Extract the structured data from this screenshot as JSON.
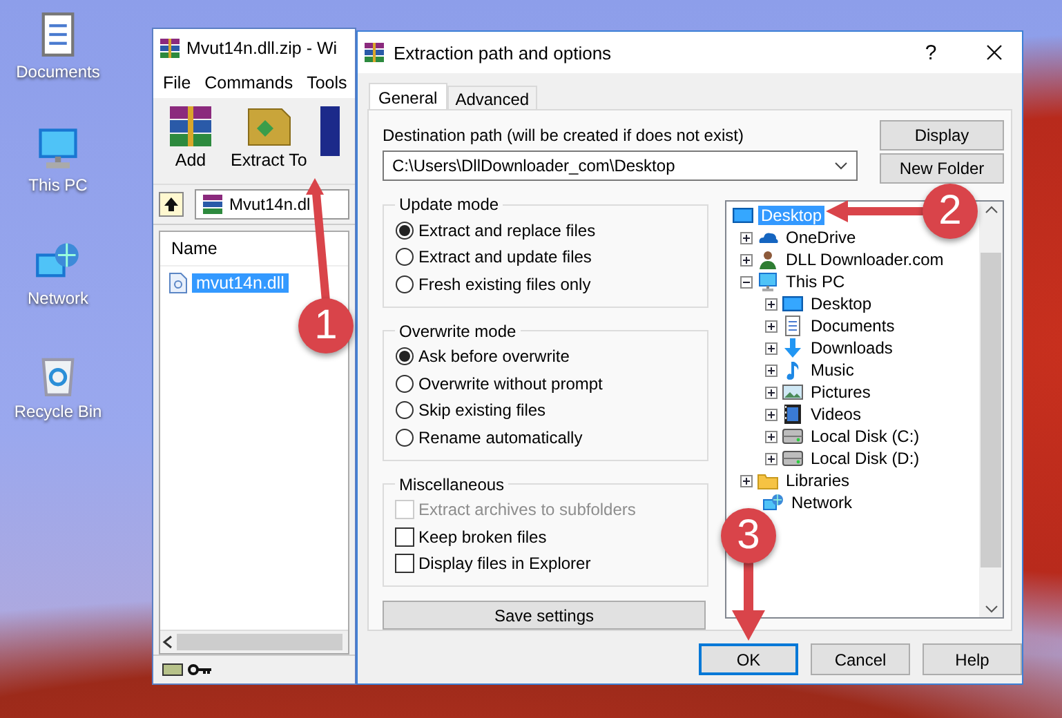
{
  "desktop_icons": [
    {
      "label": "Documents",
      "kind": "documents"
    },
    {
      "label": "This PC",
      "kind": "computer"
    },
    {
      "label": "Network",
      "kind": "network"
    },
    {
      "label": "Recycle Bin",
      "kind": "recycle"
    }
  ],
  "archive_window": {
    "title": "Mvut14n.dll.zip - Wi",
    "menu": [
      "File",
      "Commands",
      "Tools"
    ],
    "toolbar": [
      {
        "label": "Add",
        "kind": "add"
      },
      {
        "label": "Extract To",
        "kind": "extract"
      }
    ],
    "path": "Mvut14n.dl",
    "columns": [
      "Name"
    ],
    "files": [
      {
        "name": "mvut14n.dll",
        "selected": true
      }
    ]
  },
  "dialog": {
    "title": "Extraction path and options",
    "help": "?",
    "tabs": [
      {
        "label": "General",
        "selected": true
      },
      {
        "label": "Advanced",
        "selected": false
      }
    ],
    "destination": {
      "label": "Destination path (will be created if does not exist)",
      "value": "C:\\Users\\DllDownloader_com\\Desktop"
    },
    "side_buttons": [
      "Display",
      "New Folder"
    ],
    "groups": [
      {
        "title": "Update mode",
        "options": [
          {
            "kind": "radio",
            "label": "Extract and replace files",
            "selected": true
          },
          {
            "kind": "radio",
            "label": "Extract and update files",
            "selected": false
          },
          {
            "kind": "radio",
            "label": "Fresh existing files only",
            "selected": false
          }
        ]
      },
      {
        "title": "Overwrite mode",
        "options": [
          {
            "kind": "radio",
            "label": "Ask before overwrite",
            "selected": true
          },
          {
            "kind": "radio",
            "label": "Overwrite without prompt",
            "selected": false
          },
          {
            "kind": "radio",
            "label": "Skip existing files",
            "selected": false
          },
          {
            "kind": "radio",
            "label": "Rename automatically",
            "selected": false
          }
        ]
      },
      {
        "title": "Miscellaneous",
        "options": [
          {
            "kind": "checkbox",
            "label": "Extract archives to subfolders",
            "checked": false,
            "disabled": true
          },
          {
            "kind": "checkbox",
            "label": "Keep broken files",
            "checked": false,
            "disabled": false
          },
          {
            "kind": "checkbox",
            "label": "Display files in Explorer",
            "checked": false,
            "disabled": false
          }
        ]
      }
    ],
    "save_button": "Save settings",
    "tree": [
      {
        "label": "Desktop",
        "kind": "desktop",
        "selected": true,
        "children": [
          {
            "label": "OneDrive",
            "kind": "cloud",
            "selected": false,
            "expanded": false
          },
          {
            "label": "DLL Downloader.com",
            "kind": "user",
            "selected": false,
            "expanded": false
          },
          {
            "label": "This PC",
            "kind": "computer",
            "selected": false,
            "expanded": true,
            "children": [
              {
                "label": "Desktop",
                "kind": "desktop",
                "selected": false,
                "expanded": false
              },
              {
                "label": "Documents",
                "kind": "documents",
                "selected": false,
                "expanded": false
              },
              {
                "label": "Downloads",
                "kind": "downloads",
                "selected": false,
                "expanded": false
              },
              {
                "label": "Music",
                "kind": "music",
                "selected": false,
                "expanded": false
              },
              {
                "label": "Pictures",
                "kind": "pictures",
                "selected": false,
                "expanded": false
              },
              {
                "label": "Videos",
                "kind": "videos",
                "selected": false,
                "expanded": false
              },
              {
                "label": "Local Disk (C:)",
                "kind": "drive",
                "selected": false,
                "expanded": false
              },
              {
                "label": "Local Disk (D:)",
                "kind": "drive",
                "selected": false,
                "expanded": false
              }
            ]
          },
          {
            "label": "Libraries",
            "kind": "library",
            "selected": false,
            "expanded": false
          },
          {
            "label": "Network",
            "kind": "network",
            "selected": false
          }
        ]
      }
    ],
    "buttons": [
      {
        "label": "OK",
        "focused": true
      },
      {
        "label": "Cancel",
        "focused": false
      },
      {
        "label": "Help",
        "focused": false
      }
    ]
  },
  "annotations": [
    {
      "label": "1"
    },
    {
      "label": "2"
    },
    {
      "label": "3"
    }
  ]
}
